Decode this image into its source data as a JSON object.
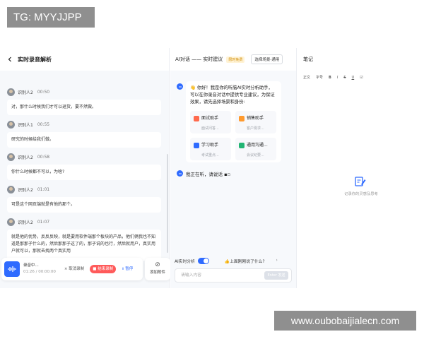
{
  "watermarks": {
    "top": "TG: MYYJJPP",
    "bottom": "www.oubobaijialecn.com"
  },
  "left_panel": {
    "title": "实时录音解析",
    "messages": [
      {
        "speaker": "识别人2",
        "time": "00:50",
        "text": "对，那什么时候我们才可以退货，要不然做。"
      },
      {
        "speaker": "识别人1",
        "time": "00:55",
        "text": "研究的时候给我们做。"
      },
      {
        "speaker": "识别人2",
        "time": "00:58",
        "text": "你什么时候都不可以，为啥?"
      },
      {
        "speaker": "识别人2",
        "time": "01:01",
        "text": "可是这个网页端就是有他的那个。"
      },
      {
        "speaker": "识别人2",
        "time": "01:07",
        "text": "就是他的优势，反反反映，就是要用软件端那个板块的产品，他们俩我也不知道是那那子什么的，然后那那子这了的，那子说的也行，然后就用户，真实用户就可以，那就去找两个真实用"
      }
    ],
    "recorder": {
      "status": "录音中...",
      "time": "01:26 / 00:00:00",
      "cancel_label": "取消录制",
      "end_label": "结束录制",
      "pause_label": "暂停",
      "attach_label": "添加附件"
    }
  },
  "middle_panel": {
    "title": "AI对话 —— 实时建议",
    "badge": "限时免费",
    "scene_button": "选择场景-通用",
    "welcome_text": "👋 你好！我是你的听脑AI实时分析助手，可以在你录音对话中提供专业建议，为保证效果，请先选择场景和身份:",
    "cards": [
      {
        "title": "面试助手",
        "sub": "面试问答...",
        "color": "#ff6a4d"
      },
      {
        "title": "销售助手",
        "sub": "客户需求...",
        "color": "#ff9a2e"
      },
      {
        "title": "学习助手",
        "sub": "考试重点...",
        "color": "#2f6bff"
      },
      {
        "title": "通用沟通...",
        "sub": "会议纪要...",
        "color": "#22b573"
      }
    ],
    "status_line": "我正在听，请说话",
    "ai_toggle_label": "AI实时分析",
    "hint": "👍上面刚刚说了什么?",
    "input_placeholder": "请输入内容",
    "send_label": "Enter 发送"
  },
  "right_panel": {
    "title": "笔记",
    "toolbar": [
      "正文",
      "字号",
      "B",
      "I",
      "S",
      "U",
      "☑"
    ],
    "empty_text": "记录你的灵感及思考"
  }
}
